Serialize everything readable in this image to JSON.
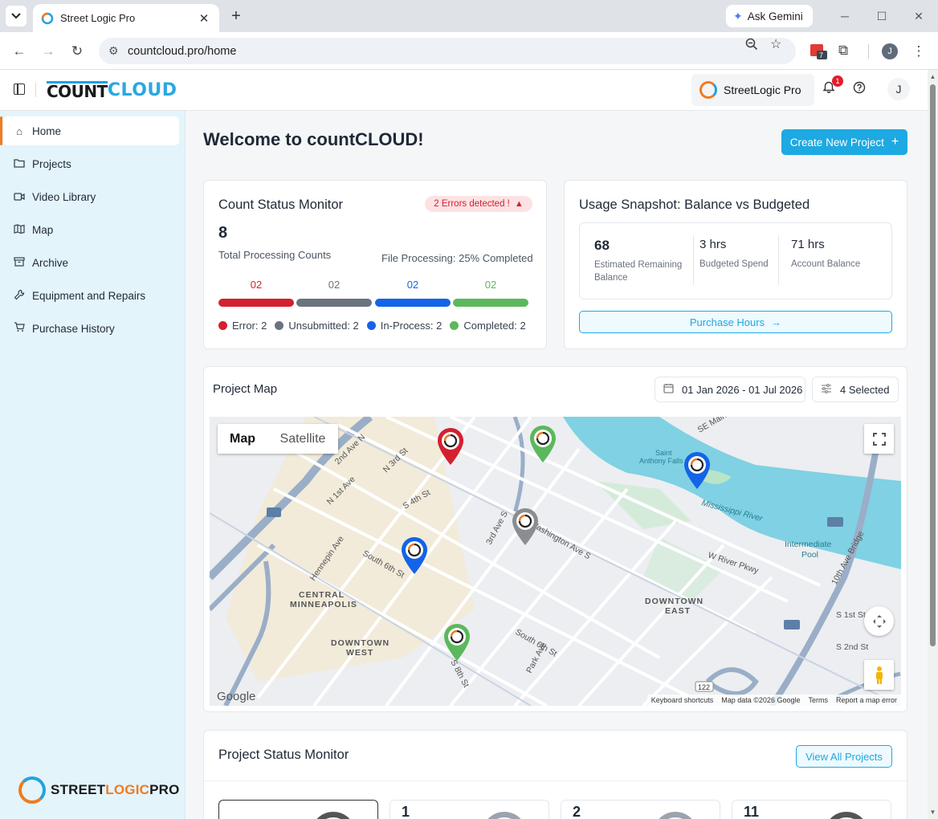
{
  "browser": {
    "tab_title": "Street Logic Pro",
    "tab_close": "✕",
    "new_tab": "+",
    "ask_gemini": "Ask Gemini",
    "url": "countcloud.pro/home",
    "ext_badge": "7",
    "profile_initial": "J"
  },
  "header": {
    "logo_count": "COUNT",
    "logo_cloud": "CLOUD",
    "org_name": "StreetLogic Pro",
    "notification_count": "1",
    "user_initial": "J"
  },
  "sidebar": {
    "items": [
      {
        "label": "Home",
        "icon": "home-icon",
        "active": true
      },
      {
        "label": "Projects",
        "icon": "folder-icon"
      },
      {
        "label": "Video Library",
        "icon": "video-icon"
      },
      {
        "label": "Map",
        "icon": "map-icon"
      },
      {
        "label": "Archive",
        "icon": "archive-icon"
      },
      {
        "label": "Equipment and Repairs",
        "icon": "wrench-icon"
      },
      {
        "label": "Purchase History",
        "icon": "cart-icon"
      }
    ],
    "footer_logo": {
      "part1": "STREET",
      "part2": "LOGIC",
      "part3": "PRO"
    }
  },
  "main": {
    "welcome": "Welcome to countCLOUD!",
    "create_project_label": "Create New Project",
    "count_status": {
      "title": "Count Status Monitor",
      "error_pill": "2 Errors detected !",
      "total": "8",
      "total_label": "Total Processing Counts",
      "file_processing": "File Processing: 25% Completed",
      "segments": [
        {
          "value": "02",
          "color": "#d4202f"
        },
        {
          "value": "02",
          "color": "#6b7280"
        },
        {
          "value": "02",
          "color": "#1463e8"
        },
        {
          "value": "02",
          "color": "#5cb85c"
        }
      ],
      "legend": [
        {
          "label": "Error: 2",
          "color": "#d4202f"
        },
        {
          "label": "Unsubmitted: 2",
          "color": "#6b7280"
        },
        {
          "label": "In-Process: 2",
          "color": "#1463e8"
        },
        {
          "label": "Completed: 2",
          "color": "#5cb85c"
        }
      ]
    },
    "usage": {
      "title": "Usage Snapshot: Balance vs Budgeted",
      "remaining_value": "68",
      "remaining_label": "Estimated Remaining Balance",
      "budgeted_value": "3 hrs",
      "budgeted_label": "Budgeted Spend",
      "account_value": "71 hrs",
      "account_label": "Account Balance",
      "purchase_label": "Purchase Hours"
    },
    "project_map": {
      "title": "Project Map",
      "date_range": "01 Jan 2026 - 01 Jul 2026",
      "selected": "4 Selected",
      "map_tab": "Map",
      "satellite_tab": "Satellite",
      "labels": [
        "CENTRAL MINNEAPOLIS",
        "DOWNTOWN WEST",
        "DOWNTOWN EAST",
        "Mississippi River",
        "Intermediate Pool",
        "Saint Anthony Falls",
        "W River Pkwy",
        "Washington Ave S",
        "S 4th St",
        "3rd Ave S",
        "Hennepin Ave",
        "S 8th St",
        "South 6th St"
      ],
      "attribution": {
        "google": "Google",
        "shortcuts": "Keyboard shortcuts",
        "data": "Map data ©2026 Google",
        "terms": "Terms",
        "report": "Report a map error"
      }
    },
    "project_status": {
      "title": "Project Status Monitor",
      "view_all_label": "View All Projects",
      "cards": [
        "",
        "1",
        "2",
        "11"
      ]
    }
  }
}
